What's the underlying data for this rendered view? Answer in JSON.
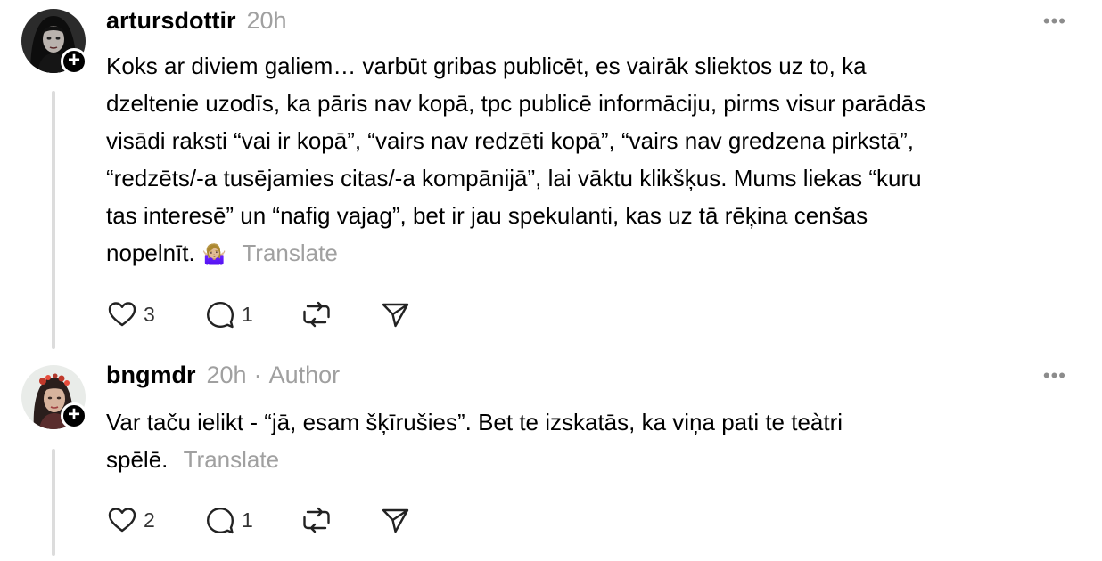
{
  "posts": [
    {
      "username": "artursdottir",
      "time": "20h",
      "body_lines": [
        "Koks ar diviem galiem… varbūt gribas publicēt, es vairāk sliektos uz to, ka",
        "dzeltenie uzodīs, ka pāris nav kopā, tpc publicē informāciju, pirms visur parādās",
        "visādi raksti “vai ir kopā”, “vairs nav redzēti kopā”, “vairs nav gredzena pirkstā”,",
        "“redzēts/-a tusējamies citas/-a kompānijā”, lai vāktu klikšķus. Mums liekas “kuru",
        "tas interesē” un “nafig vajag”, bet ir jau spekulanti, kas uz tā rēķina cenšas"
      ],
      "body_last_line": "nopelnīt.",
      "emoji": "🤷🏼‍♀️",
      "translate_label": "Translate",
      "likes": "3",
      "replies": "1"
    },
    {
      "username": "bngmdr",
      "time": "20h",
      "separator": "·",
      "author_label": "Author",
      "body_lines": [
        "Var taču ielikt - “jā, esam šķīrušies”. Bet te izskatās, ka viņa pati te teàtri"
      ],
      "body_last_line": "spēlē.",
      "translate_label": "Translate",
      "likes": "2",
      "replies": "1"
    }
  ],
  "icons": {
    "follow": "plus-icon",
    "more": "more-horizontal-icon",
    "like": "heart-icon",
    "reply": "comment-icon",
    "repost": "repost-icon",
    "share": "send-icon"
  }
}
